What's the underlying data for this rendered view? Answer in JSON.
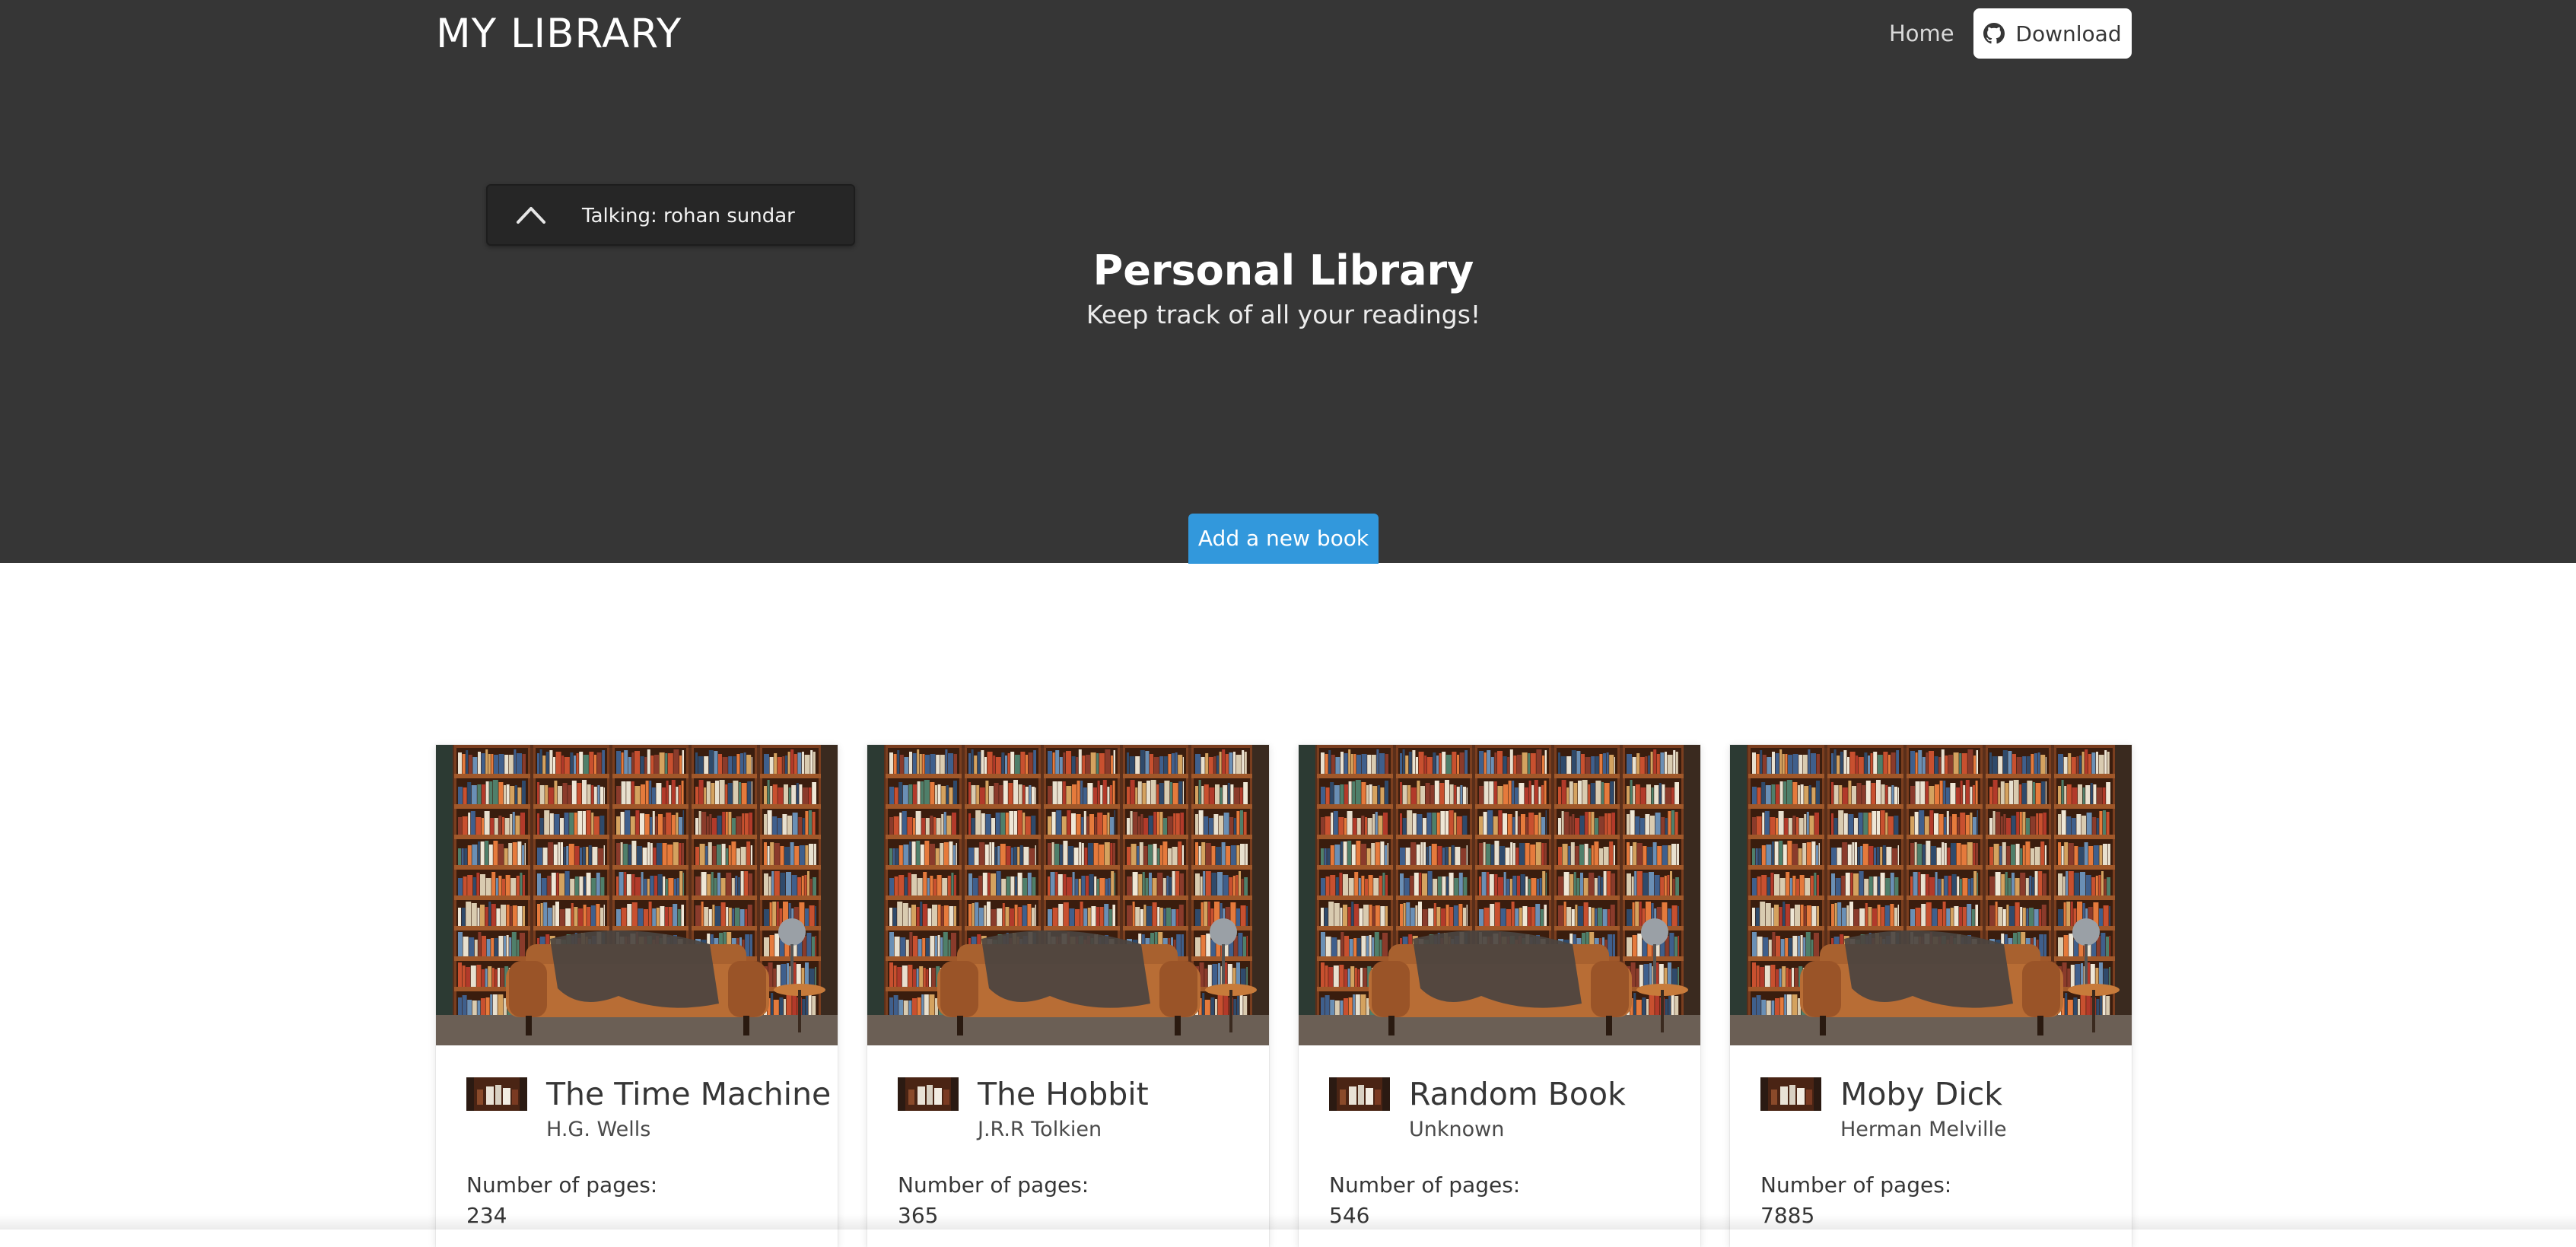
{
  "navbar": {
    "brand": "MY LIBRARY",
    "home_label": "Home",
    "download_label": "Download",
    "download_icon": "github-icon"
  },
  "talking_box": {
    "icon": "chevron-up-icon",
    "text": "Talking: rohan sundar"
  },
  "hero": {
    "title": "Personal Library",
    "subtitle": "Keep track of all your readings!",
    "add_button_label": "Add a new book"
  },
  "books": [
    {
      "title": "The Time Machine",
      "author": "H.G. Wells",
      "pages_label": "Number of pages:",
      "pages": "234"
    },
    {
      "title": "The Hobbit",
      "author": "J.R.R Tolkien",
      "pages_label": "Number of pages:",
      "pages": "365"
    },
    {
      "title": "Random Book",
      "author": "Unknown",
      "pages_label": "Number of pages:",
      "pages": "546"
    },
    {
      "title": "Moby Dick",
      "author": "Herman Melville",
      "pages_label": "Number of pages:",
      "pages": "7885"
    }
  ],
  "colors": {
    "hero_background": "#363636",
    "primary_button": "#3298dc",
    "text_dark": "#363636"
  }
}
